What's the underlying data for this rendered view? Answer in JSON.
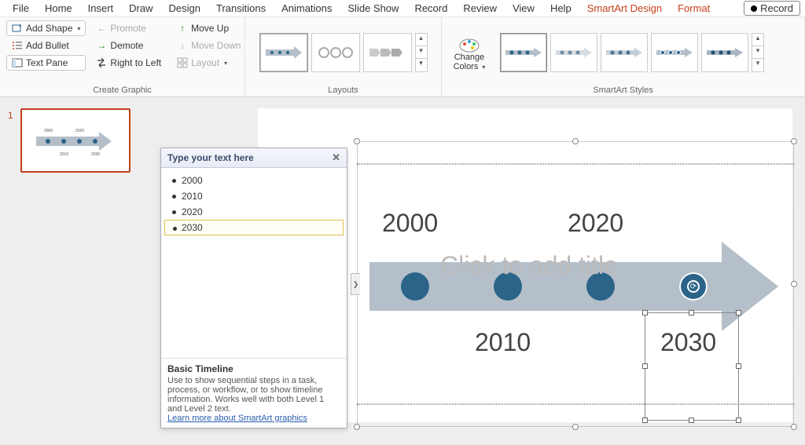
{
  "menu": {
    "items": [
      "File",
      "Home",
      "Insert",
      "Draw",
      "Design",
      "Transitions",
      "Animations",
      "Slide Show",
      "Record",
      "Review",
      "View",
      "Help",
      "SmartArt Design",
      "Format"
    ],
    "active": "SmartArt Design",
    "record_button": "Record"
  },
  "ribbon": {
    "create_graphic": {
      "label": "Create Graphic",
      "add_shape": "Add Shape",
      "add_bullet": "Add Bullet",
      "text_pane": "Text Pane",
      "promote": "Promote",
      "demote": "Demote",
      "right_to_left": "Right to Left",
      "move_up": "Move Up",
      "move_down": "Move Down",
      "layout": "Layout"
    },
    "layouts": {
      "label": "Layouts"
    },
    "change_colors": {
      "label1": "Change",
      "label2": "Colors"
    },
    "styles": {
      "label": "SmartArt Styles"
    }
  },
  "thumb": {
    "slide_number": "1"
  },
  "text_pane": {
    "title": "Type your text here",
    "items": [
      "2000",
      "2010",
      "2020",
      "2030"
    ],
    "selected_index": 3,
    "footer_title": "Basic Timeline",
    "footer_desc": "Use to show sequential steps in a task, process, or workflow, or to show timeline information. Works well with both Level 1 and Level 2 text.",
    "footer_link": "Learn more about SmartArt graphics"
  },
  "canvas": {
    "title_placeholder": "Click to add title",
    "years": [
      "2000",
      "2010",
      "2020",
      "2030"
    ]
  },
  "colors": {
    "accent": "#2b6488",
    "arrow": "#b4bfc9",
    "brand": "#c43e1c"
  }
}
